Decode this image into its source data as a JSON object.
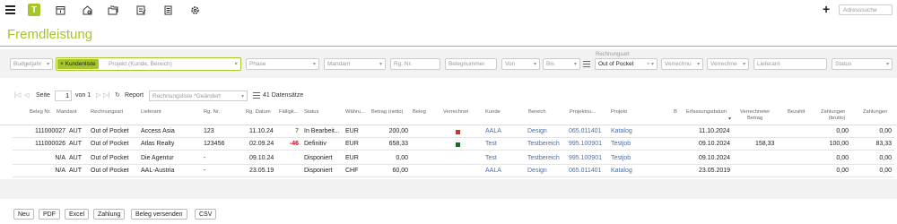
{
  "toolbar": {
    "active_letter": "T",
    "plus_label": "+",
    "search_placeholder": "Adresssuche"
  },
  "page": {
    "title": "Fremdleistung"
  },
  "filters": {
    "budgetjahr": "Budgetjahr",
    "kundenliste": "Kundenliste",
    "projekt_placeholder": "Projekt (Kunde, Bereich)",
    "phase": "Phase",
    "mandant": "Mandant",
    "rg_nr": "Rg. Nr.",
    "belegnummer": "Belegnummer",
    "von": "Von",
    "bis": "Bis",
    "rechnungsart_label": "Rechnungsart",
    "rechnungsart_value": "Out of Pocket",
    "verrechnung": "Verrechnu",
    "verrechnet": "Verrechne",
    "lieferant": "Lieferant",
    "status": "Status"
  },
  "reportbar": {
    "seite": "Seite",
    "page_value": "1",
    "von": "von 1",
    "report_label": "Report",
    "report_select": "Rechnungsliste *Geändert",
    "count": "41 Datensätze"
  },
  "columns": {
    "belegnr": "Beleg Nr.",
    "mandant": "Mandant",
    "rechnungsart": "Rechnungsart",
    "lieferant": "Lieferant",
    "rgnr": "Rg. Nr.",
    "rgdatum": "Rg. Datum",
    "faellig": "Fälligk...",
    "status": "Status",
    "waehrung": "Währu...",
    "betrag": "Betrag (netto)",
    "beleg": "Beleg",
    "verrechnet": "Verrechnet",
    "kunde": "Kunde",
    "bereich": "Bereich",
    "projektnr": "Projektnu...",
    "projekt": "Projekt",
    "b": "B",
    "erfassung": "Erfassungsdatum",
    "verrechneter": "Verrechneter",
    "verrechneter2": "Betrag",
    "bezahlt": "Bezahlt",
    "zahlungen_brutto": "Zahlungen",
    "zahlungen_brutto2": "(brutto)",
    "zahlungen": "Zahlungen"
  },
  "rows": [
    {
      "belegnr": "111000027",
      "mandant": "AUT",
      "rechnungsart": "Out of Pocket",
      "lieferant": "Access Asia",
      "rgnr": "123",
      "rgdatum": "11.10.24",
      "faellig": "7",
      "faellig_color": "green",
      "status": "In Bearbeit...",
      "waehrung": "EUR",
      "betrag": "200,00",
      "verrechnet_color": "#c0392b",
      "kunde": "AALA",
      "bereich": "Design",
      "projektnr": "065.011401",
      "projekt": "Katalog",
      "erfassung": "11.10.2024",
      "verrechneter": "",
      "bezahlt": "",
      "zb": "0,00",
      "z": "0,00"
    },
    {
      "belegnr": "111000026",
      "mandant": "AUT",
      "rechnungsart": "Out of Pocket",
      "lieferant": "Atlas Realty",
      "rgnr": "123456",
      "rgdatum": "02.09.24",
      "faellig": "-46",
      "faellig_color": "red",
      "status": "Definitiv",
      "waehrung": "EUR",
      "betrag": "658,33",
      "verrechnet_color": "#1e6b2e",
      "kunde": "Test",
      "bereich": "Testbereich",
      "projektnr": "995.100901",
      "projekt": "Testjob",
      "erfassung": "09.10.2024",
      "verrechneter": "158,33",
      "bezahlt": "",
      "zb": "100,00",
      "z": "83,33"
    },
    {
      "belegnr": "N/A",
      "mandant": "AUT",
      "rechnungsart": "Out of Pocket",
      "lieferant": "Die Agentur",
      "rgnr": "-",
      "rgdatum": "09.10.24",
      "faellig": "",
      "faellig_color": "",
      "status": "Disponiert",
      "waehrung": "EUR",
      "betrag": "0,00",
      "verrechnet_color": "",
      "kunde": "Test",
      "bereich": "Testbereich",
      "projektnr": "995.100901",
      "projekt": "Testjob",
      "erfassung": "09.10.2024",
      "verrechneter": "",
      "bezahlt": "",
      "zb": "0,00",
      "z": "0,00"
    },
    {
      "belegnr": "N/A",
      "mandant": "AUT",
      "rechnungsart": "Out of Pocket",
      "lieferant": "AAL-Austria",
      "rgnr": "-",
      "rgdatum": "23.05.19",
      "faellig": "",
      "faellig_color": "",
      "status": "Disponiert",
      "waehrung": "CHF",
      "betrag": "60,00",
      "verrechnet_color": "",
      "kunde": "AALA",
      "bereich": "Design",
      "projektnr": "065.011401",
      "projekt": "Katalog",
      "erfassung": "23.05.2019",
      "verrechneter": "",
      "bezahlt": "",
      "zb": "0,00",
      "z": "0,00"
    }
  ],
  "buttons": [
    "Neu",
    "PDF",
    "Excel",
    "Zahlung",
    "Beleg versenden",
    "CSV"
  ],
  "colors": {
    "accent": "#a5c52b",
    "link": "#4a6fa5",
    "overdue": "#d0021b",
    "ok": "#5a9e2f"
  }
}
